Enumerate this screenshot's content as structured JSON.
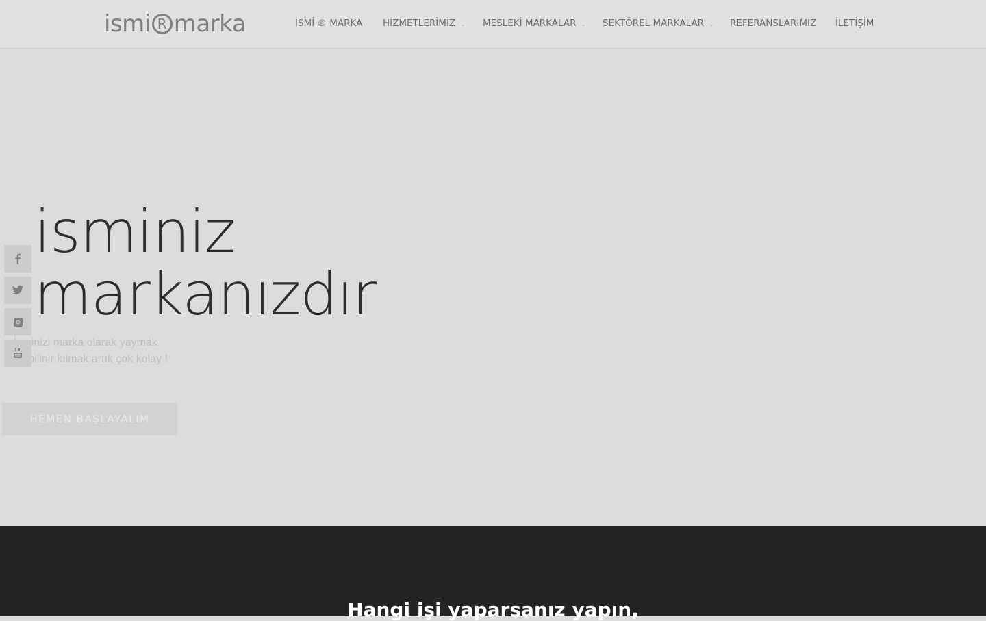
{
  "logo": {
    "left": "ismi",
    "mark": "R",
    "right": "marka"
  },
  "nav": {
    "items": [
      {
        "label": "İSMİ ® MARKA",
        "dropdown": false
      },
      {
        "label": "HİZMETLERİMİZ",
        "dropdown": true
      },
      {
        "label": "MESLEKİ MARKALAR",
        "dropdown": true
      },
      {
        "label": "SEKTÖREL MARKALAR",
        "dropdown": true
      },
      {
        "label": "REFERANSLARIMIZ",
        "dropdown": false
      },
      {
        "label": "İLETİŞİM",
        "dropdown": false
      }
    ],
    "chevron_glyph": "⌄"
  },
  "hero": {
    "title_line1": "isminiz",
    "title_line2": "markanızdır",
    "subtitle_line1": "İsminizi marka olarak yaymak",
    "subtitle_line2": "ve bilinir kılmak artık çok kolay !",
    "cta_label": "HEMEN BAŞLAYALIM"
  },
  "social": [
    {
      "name": "facebook-icon"
    },
    {
      "name": "twitter-icon"
    },
    {
      "name": "instagram-icon"
    },
    {
      "name": "youtube-icon"
    }
  ],
  "section2": {
    "heading": "Hangi işi yaparsanız yapın,"
  },
  "colors": {
    "header_bg": "#e1e1e1",
    "hero_bg": "#dcdcdc",
    "dark_bg": "#242424",
    "nav_text": "#6f6f6f",
    "title_text": "#2d2d2d"
  }
}
